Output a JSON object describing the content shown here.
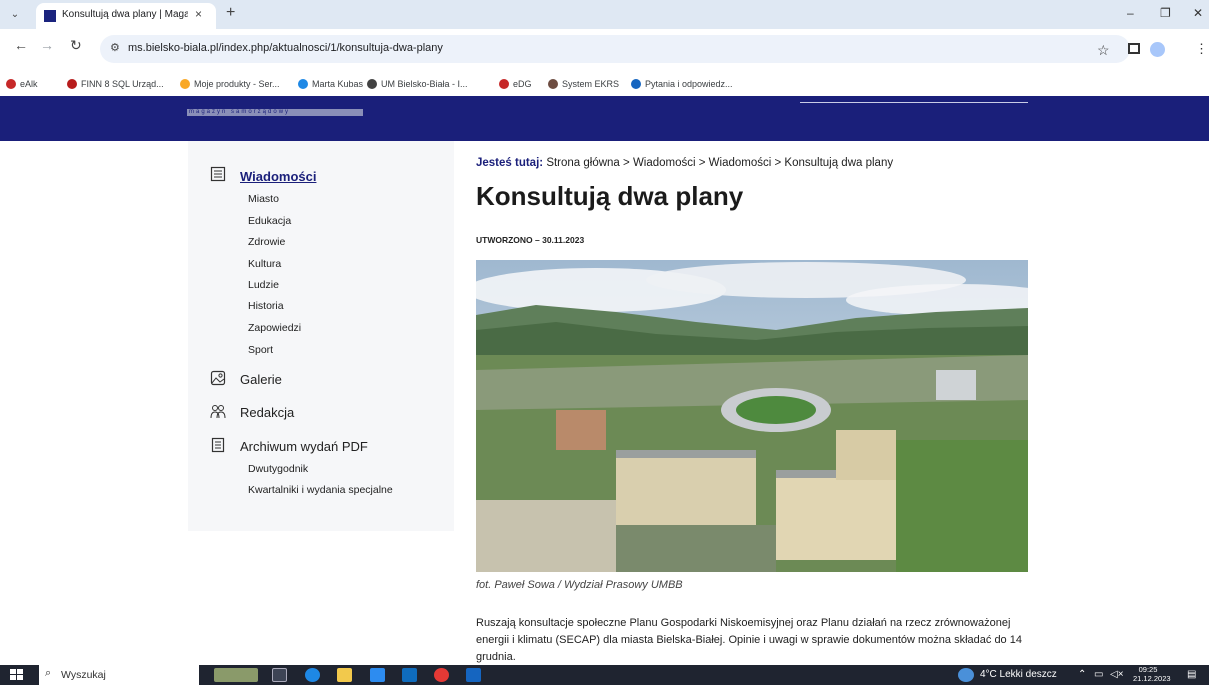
{
  "browser": {
    "tab_title": "Konsultują dwa plany | Magazyn",
    "tab_close": "×",
    "new_tab": "+",
    "url": "ms.bielsko-biala.pl/index.php/aktualnosci/1/konsultuja-dwa-plany",
    "bookmarks": [
      {
        "label": "eAlk",
        "color": "#c62828"
      },
      {
        "label": "FINN 8 SQL Urząd...",
        "color": "#b71c1c"
      },
      {
        "label": "Moje produkty - Ser...",
        "color": "#f9a825"
      },
      {
        "label": "Marta Kubas",
        "color": "#1e88e5"
      },
      {
        "label": "UM Bielsko-Biała - I...",
        "color": "#424242"
      },
      {
        "label": "eDG",
        "color": "#c62828"
      },
      {
        "label": "System EKRS",
        "color": "#6d4c41"
      },
      {
        "label": "Pytania i odpowiedz...",
        "color": "#1565c0"
      }
    ]
  },
  "site": {
    "logo_tagline": "magazyn samorządowy"
  },
  "sidebar": {
    "news": {
      "label": "Wiadomości",
      "icon": "newspaper-icon",
      "items": [
        "Miasto",
        "Edukacja",
        "Zdrowie",
        "Kultura",
        "Ludzie",
        "Historia",
        "Zapowiedzi",
        "Sport"
      ]
    },
    "gallery": {
      "label": "Galerie",
      "icon": "image-icon"
    },
    "editorial": {
      "label": "Redakcja",
      "icon": "people-icon"
    },
    "archive": {
      "label": "Archiwum wydań PDF",
      "icon": "document-icon",
      "items": [
        "Dwutygodnik",
        "Kwartalniki i wydania specjalne"
      ]
    }
  },
  "article": {
    "breadcrumb_label": "Jesteś tutaj:",
    "breadcrumb_path": "Strona główna > Wiadomości > Wiadomości > Konsultują dwa plany",
    "title": "Konsultują dwa plany",
    "meta": "UTWORZONO – 30.11.2023",
    "caption": "fot. Paweł Sowa / Wydział Prasowy UMBB",
    "lead": "Ruszają konsultacje społeczne Planu Gospodarki Niskoemisyjnej oraz Planu działań na rzecz zrównoważonej energii i klimatu (SECAP) dla miasta Bielska-Białej. Opinie i uwagi w sprawie dokumentów można składać do 14 grudnia."
  },
  "taskbar": {
    "search_placeholder": "Wyszukaj",
    "weather": "4°C  Lekki deszcz",
    "time": "09:25",
    "date": "21.12.2023"
  }
}
